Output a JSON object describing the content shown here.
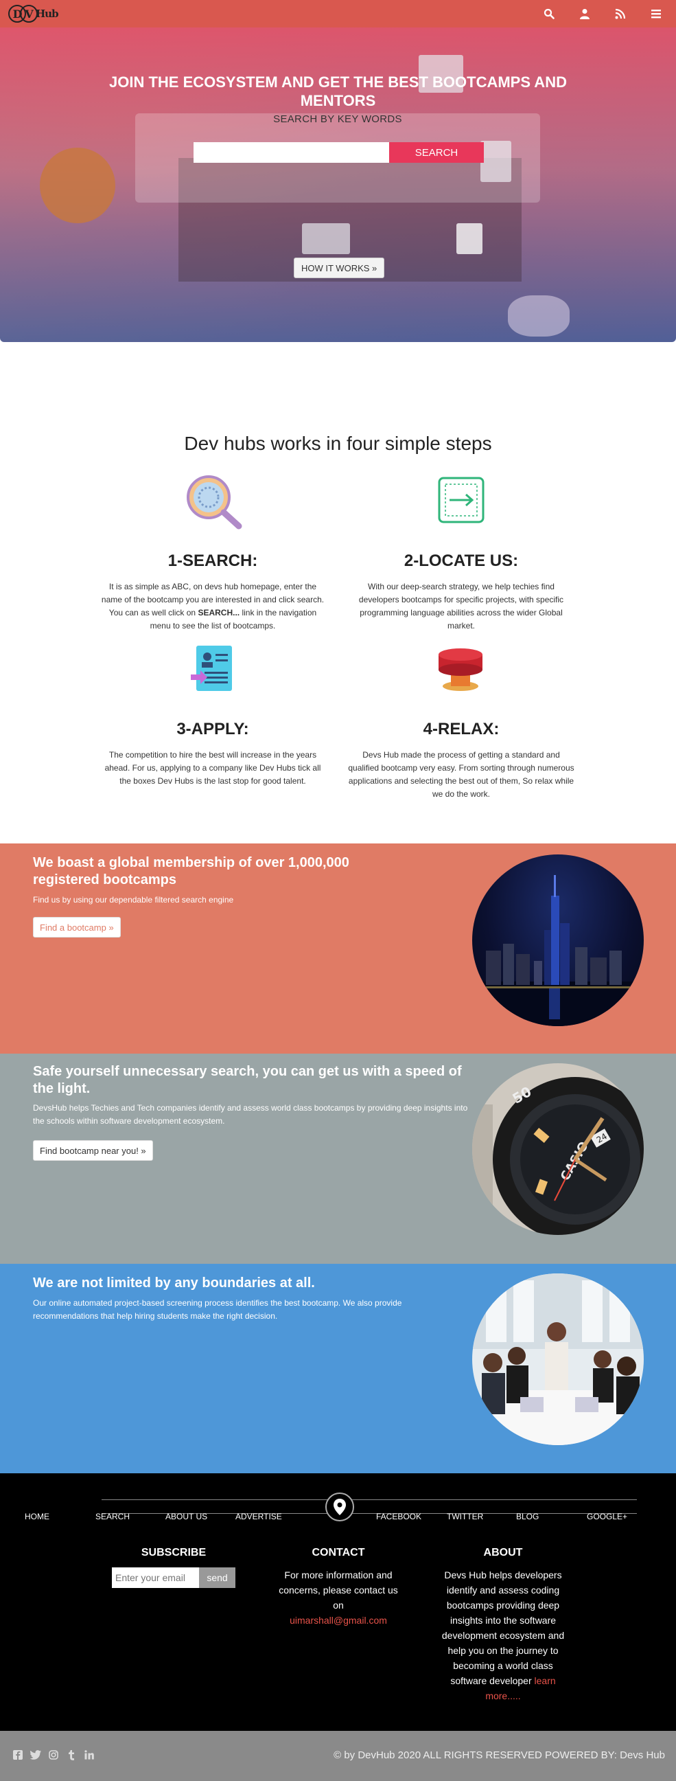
{
  "brand": {
    "logo_d": "D",
    "logo_v": "V",
    "logo_text": "Hub"
  },
  "navbar": {
    "icons": [
      "search-icon",
      "user-icon",
      "rss-icon",
      "menu-icon"
    ]
  },
  "hero": {
    "title_line1": "JOIN THE ECOSYSTEM AND GET THE BEST BOOTCAMPS AND",
    "title_line2": "MENTORS",
    "search_label": "SEARCH BY KEY WORDS",
    "search_placeholder": "",
    "search_button": "SEARCH",
    "how_button": "HOW IT WORKS »"
  },
  "steps": {
    "title": "Dev hubs works in four simple steps",
    "items": [
      {
        "heading": "1-SEARCH:",
        "text_before": "It is as simple as ABC, on devs hub homepage, enter the name of the bootcamp you are interested in and click search. You can as well click on ",
        "text_bold": "SEARCH...",
        "text_after": " link in the navigation menu to see the list of bootcamps.",
        "icon": "magnifier-icon"
      },
      {
        "heading": "2-LOCATE US:",
        "text": "With our deep-search strategy, we help techies find developers bootcamps for specific projects, with specific programming language abilities across the wider Global market.",
        "icon": "locate-arrow-icon"
      },
      {
        "heading": "3-APPLY:",
        "text": "The competition to hire the best will increase in the years ahead. For us, applying to a company like Dev Hubs tick all the boxes Dev Hubs is the last stop for good talent.",
        "icon": "resume-icon"
      },
      {
        "heading": "4-RELAX:",
        "text": "Devs Hub made the process of getting a standard and qualified bootcamp very easy. From sorting through numerous applications and selecting the best out of them, So relax while we do the work.",
        "icon": "relax-button-icon"
      }
    ]
  },
  "bands": [
    {
      "title": "We boast a global membership of over 1,000,000 registered bootcamps",
      "text": "Find us by using our dependable filtered search engine",
      "button": "Find a bootcamp »",
      "bg": "#e07b65",
      "image": "city-skyline-night"
    },
    {
      "title": "Safe yourself unnecessary search, you can get us with a speed of the light.",
      "text": "DevsHub helps Techies and Tech companies identify and assess world class bootcamps by providing deep insights into the schools within software development ecosystem.",
      "button": "Find bootcamp near you! »",
      "bg": "#9aa5a6",
      "image": "wristwatch",
      "watch_brand": "CASIO",
      "watch_date": "24",
      "watch_bezel": "50"
    },
    {
      "title": "We are not limited by any boundaries at all.",
      "text": "Our online automated project-based screening process identifies the best bootcamp. We also provide recommendations that help hiring students make the right decision.",
      "bg": "#4e97d8",
      "image": "team-meeting"
    }
  ],
  "footer": {
    "nav_left": [
      "HOME",
      "SEARCH",
      "ABOUT US",
      "ADVERTISE"
    ],
    "nav_right": [
      "FACEBOOK",
      "TWITTER",
      "BLOG",
      "GOOGLE+"
    ],
    "subscribe": {
      "heading": "SUBSCRIBE",
      "placeholder": "Enter your email",
      "button": "send"
    },
    "contact": {
      "heading": "CONTACT",
      "text": "For more information and concerns, please contact us on",
      "email": "uimarshall@gmail.com"
    },
    "about": {
      "heading": "ABOUT",
      "text": "Devs Hub helps developers identify and assess coding bootcamps providing deep insights into the software development ecosystem and help you on the journey to becoming a world class software developer",
      "link": "learn more....."
    },
    "socials": [
      "facebook-icon",
      "twitter-icon",
      "instagram-icon",
      "tumblr-icon",
      "linkedin-icon"
    ],
    "copyright": "© by DevHub 2020 ALL RIGHTS RESERVED POWERED BY: Devs Hub"
  },
  "colors": {
    "navbar": "#d9584f",
    "search_button": "#e8375a",
    "link_red": "#e8534a"
  }
}
